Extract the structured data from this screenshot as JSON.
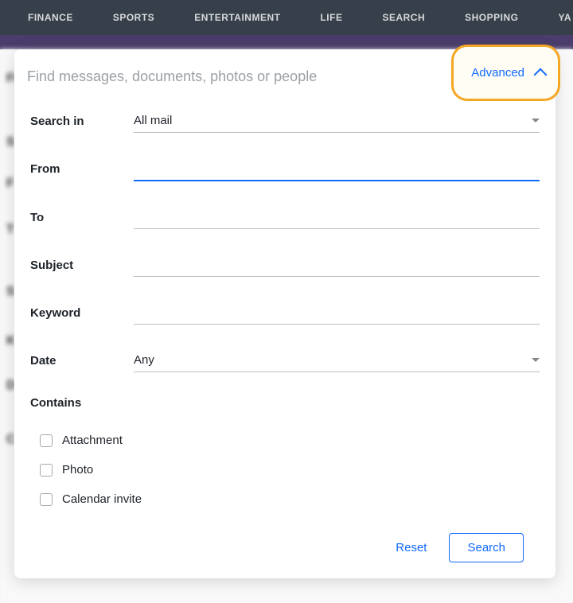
{
  "topnav": {
    "items": [
      "FINANCE",
      "SPORTS",
      "ENTERTAINMENT",
      "LIFE",
      "SEARCH",
      "SHOPPING",
      "YA"
    ]
  },
  "search": {
    "placeholder": "Find messages, documents, photos or people",
    "advanced_label": "Advanced"
  },
  "form": {
    "search_in_label": "Search in",
    "search_in_value": "All mail",
    "from_label": "From",
    "from_value": "",
    "to_label": "To",
    "to_value": "",
    "subject_label": "Subject",
    "subject_value": "",
    "keyword_label": "Keyword",
    "keyword_value": "",
    "date_label": "Date",
    "date_value": "Any",
    "contains_label": "Contains",
    "checkboxes": [
      {
        "label": "Attachment",
        "checked": false
      },
      {
        "label": "Photo",
        "checked": false
      },
      {
        "label": "Calendar invite",
        "checked": false
      }
    ]
  },
  "actions": {
    "reset": "Reset",
    "search": "Search"
  },
  "colors": {
    "accent_blue": "#0f69ff",
    "highlight_orange": "#f5a623",
    "topnav_bg": "#37404a"
  },
  "blurred_letters": [
    "Fi",
    "S",
    "F",
    "T",
    "S",
    "K",
    "D",
    "C"
  ]
}
